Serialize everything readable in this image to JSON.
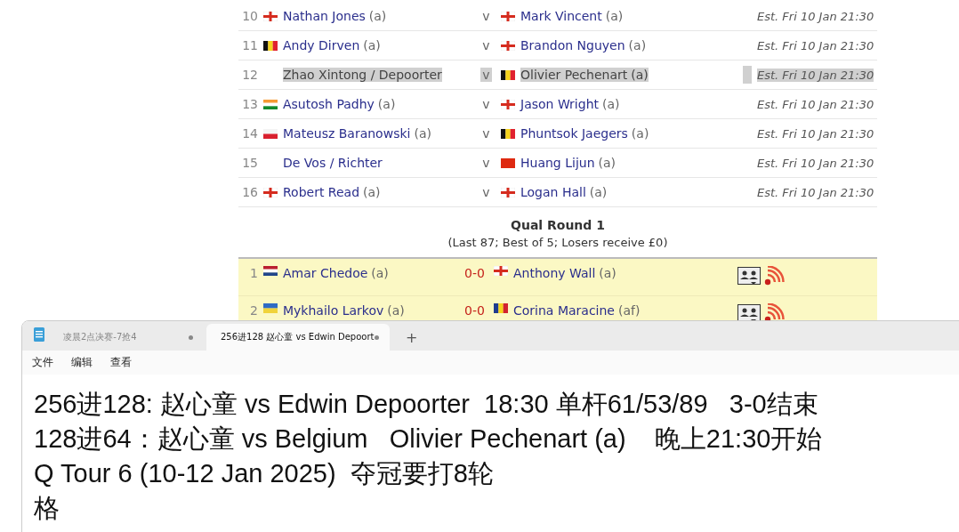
{
  "web_page": {
    "matches": [
      {
        "number": "10",
        "player1": {
          "kind": "england",
          "name": "Nathan Jones",
          "suffix": "(a)"
        },
        "separator": "v",
        "player2": {
          "kind": "england",
          "name": "Mark Vincent",
          "suffix": "(a)"
        },
        "time": "Est. Fri 10 Jan 21:30",
        "highlighted": false
      },
      {
        "number": "11",
        "player1": {
          "kind": "belgium",
          "name": "Andy Dirven",
          "suffix": "(a)"
        },
        "separator": "v",
        "player2": {
          "kind": "england",
          "name": "Brandon Nguyen",
          "suffix": "(a)"
        },
        "time": "Est. Fri 10 Jan 21:30",
        "highlighted": false
      },
      {
        "number": "12",
        "player1": {
          "name": "Zhao Xintong / Depoorter"
        },
        "separator": "v",
        "player2": {
          "kind": "belgium",
          "name": "Olivier Pechenart",
          "suffix": "(a)"
        },
        "time": "Est. Fri 10 Jan 21:30",
        "highlighted": true
      },
      {
        "number": "13",
        "player1": {
          "kind": "india",
          "name": "Asutosh Padhy",
          "suffix": "(a)"
        },
        "separator": "v",
        "player2": {
          "kind": "england",
          "name": "Jason Wright",
          "suffix": "(a)"
        },
        "time": "Est. Fri 10 Jan 21:30",
        "highlighted": false
      },
      {
        "number": "14",
        "player1": {
          "kind": "poland",
          "name": "Mateusz Baranowski",
          "suffix": "(a)"
        },
        "separator": "v",
        "player2": {
          "kind": "belgium",
          "name": "Phuntsok Jaegers",
          "suffix": "(a)"
        },
        "time": "Est. Fri 10 Jan 21:30",
        "highlighted": false
      },
      {
        "number": "15",
        "player1": {
          "name": "De Vos / Richter"
        },
        "separator": "v",
        "player2": {
          "kind": "china",
          "name": "Huang Lijun",
          "suffix": "(a)"
        },
        "time": "Est. Fri 10 Jan 21:30",
        "highlighted": false
      },
      {
        "number": "16",
        "player1": {
          "kind": "england",
          "name": "Robert Read",
          "suffix": "(a)"
        },
        "separator": "v",
        "player2": {
          "kind": "england",
          "name": "Logan Hall",
          "suffix": "(a)"
        },
        "time": "Est. Fri 10 Jan 21:30",
        "highlighted": false
      }
    ],
    "round": {
      "title": "Qual Round 1",
      "subtitle": "(Last 87; Best of 5; Losers receive £0)"
    },
    "qual_matches": [
      {
        "number": "1",
        "player1": {
          "kind": "netherlands",
          "name": "Amar Chedoe",
          "suffix": "(a)"
        },
        "score": "0-0",
        "player2": {
          "kind": "england",
          "name": "Anthony Wall",
          "suffix": "(a)"
        }
      },
      {
        "number": "2",
        "player1": {
          "kind": "ukraine",
          "name": "Mykhailo Larkov",
          "suffix": "(a)"
        },
        "score": "0-0",
        "player2": {
          "kind": "romania",
          "name": "Corina Maracine",
          "suffix": "(af)"
        }
      }
    ]
  },
  "notepad": {
    "tabs": [
      {
        "label": "凌晨2点决赛-7抢4",
        "selected": false,
        "unsaved": true
      },
      {
        "label": "256进128 赵心童 vs Edwin Depoort",
        "selected": true,
        "unsaved": true
      }
    ],
    "add_tab": "+",
    "menu": [
      "文件",
      "编辑",
      "查看"
    ],
    "lines": [
      "256进128: 赵心童 vs Edwin Depoorter  18:30 单杆61/53/89   3-0结束",
      "128进64：赵心童 vs Belgium   Olivier Pechenart (a)    晚上21:30开始",
      "Q Tour 6 (10-12 Jan 2025)  夺冠要打8轮",
      "格"
    ]
  }
}
